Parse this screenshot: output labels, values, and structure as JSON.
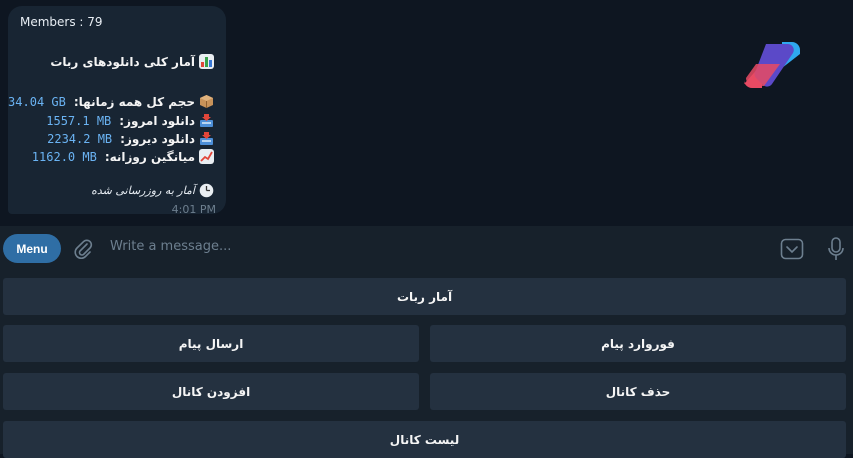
{
  "message": {
    "members_label": "Members : 79",
    "title": "آمار کلی دانلودهای ربات",
    "stats": [
      {
        "label": "حجم کل همه زمانها:",
        "value": "34.04 GB",
        "icon": "package-icon"
      },
      {
        "label": "دانلود امروز:",
        "value": "1557.1 MB",
        "icon": "inbox-tray-icon"
      },
      {
        "label": "دانلود دیروز:",
        "value": "2234.2 MB",
        "icon": "inbox-tray-icon"
      },
      {
        "label": "میانگین روزانه:",
        "value": "1162.0 MB",
        "icon": "chart-increasing-icon"
      }
    ],
    "updated_note": "آمار به روزرسانی شده",
    "time": "4:01 PM"
  },
  "composer": {
    "menu_label": "Menu",
    "placeholder": "Write a message..."
  },
  "keyboard": {
    "bot_stats": "آمار ربات",
    "forward_message": "فوروارد پیام",
    "send_message": "ارسال پیام",
    "delete_channel": "حذف کانال",
    "add_channel": "افزودن کانال",
    "channel_list": "لیست کانال"
  },
  "colors": {
    "chat_bg": "#0e1621",
    "bubble_bg": "#182533",
    "accent": "#2f6ea5",
    "link": "#6ab3f3",
    "keyboard_button": "#243140"
  }
}
